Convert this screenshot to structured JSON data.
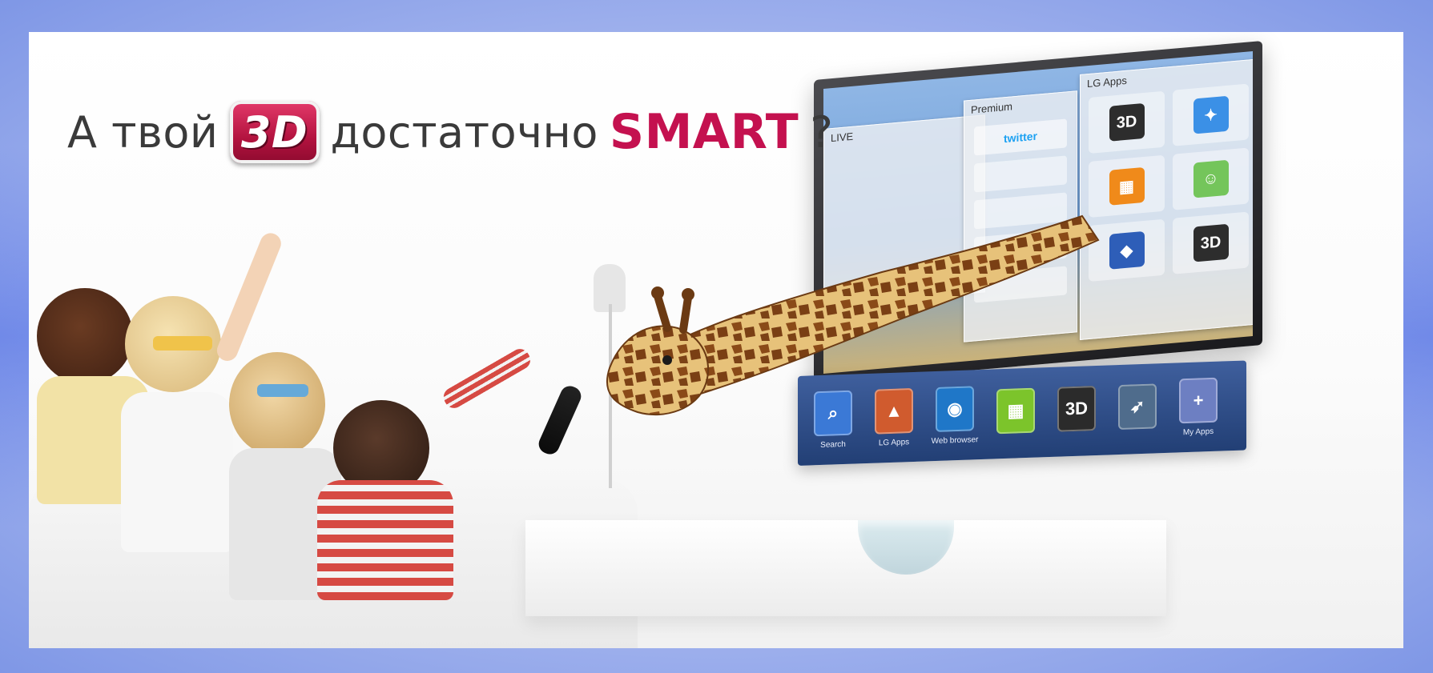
{
  "headline": {
    "prefix": "А твой",
    "badge": "3D",
    "middle": "достаточно",
    "accent": "SMART",
    "suffix": "?"
  },
  "tv": {
    "live_label": "LIVE",
    "premium_title": "Premium",
    "premium_items": [
      "twitter"
    ],
    "lgapps_title": "LG Apps",
    "lgapps_tiles": [
      {
        "label": "3D",
        "icon": "3d-world-icon"
      },
      {
        "label": "",
        "icon": "puzzle-icon"
      },
      {
        "label": "",
        "icon": "game-tiles-icon"
      },
      {
        "label": "",
        "icon": "cartoon-icon"
      },
      {
        "label": "",
        "icon": "gem-icon"
      },
      {
        "label": "3D",
        "icon": "3d-world-icon"
      }
    ]
  },
  "launcher": {
    "items": [
      {
        "label": "Search",
        "glyph": "⌕",
        "icon": "search-icon"
      },
      {
        "label": "LG Apps",
        "glyph": "▲",
        "icon": "lg-apps-icon"
      },
      {
        "label": "Web browser",
        "glyph": "◉",
        "icon": "web-browser-icon"
      },
      {
        "label": "",
        "glyph": "▦",
        "icon": "cube-game-icon"
      },
      {
        "label": "",
        "glyph": "3D",
        "icon": "3d-world-icon"
      },
      {
        "label": "",
        "glyph": "➶",
        "icon": "arrow-game-icon"
      },
      {
        "label": "My Apps",
        "glyph": "+",
        "icon": "my-apps-icon"
      }
    ]
  },
  "colors": {
    "accent_magenta": "#c4114f",
    "badge_red": "#b3133f",
    "launcher_blue": "#2b4a86",
    "frame_blue": "#8aa0ea"
  }
}
